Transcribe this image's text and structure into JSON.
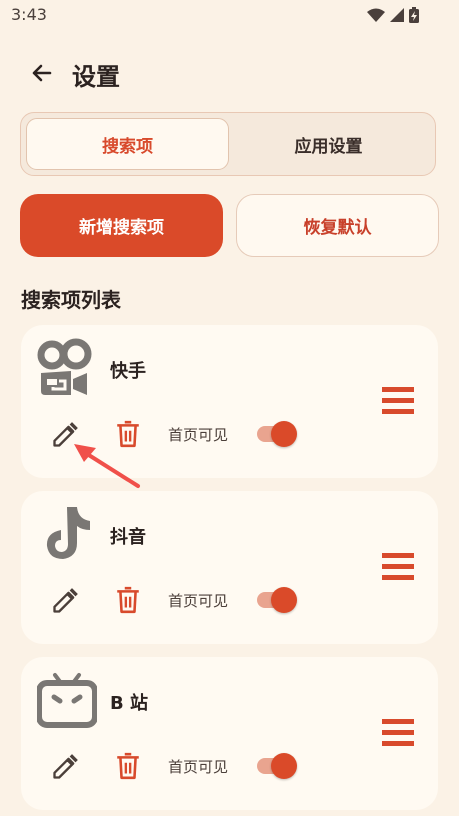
{
  "status_bar": {
    "time": "3:43"
  },
  "app_bar": {
    "title": "设置"
  },
  "tabs": [
    {
      "label": "搜索项",
      "active": true
    },
    {
      "label": "应用设置",
      "active": false
    }
  ],
  "actions": {
    "add_label": "新增搜索项",
    "reset_label": "恢复默认"
  },
  "section_title": "搜索项列表",
  "items": [
    {
      "name": "快手",
      "icon": "kuaishou-icon",
      "visible_label": "首页可见",
      "visible_on_home": true
    },
    {
      "name": "抖音",
      "icon": "douyin-icon",
      "visible_label": "首页可见",
      "visible_on_home": true
    },
    {
      "name": "B 站",
      "icon": "bilibili-icon",
      "visible_label": "首页可见",
      "visible_on_home": true
    }
  ],
  "colors": {
    "accent": "#da4a29",
    "background": "#fbf2e6",
    "card": "#fffaf2",
    "icon_gray": "#7a7774"
  }
}
